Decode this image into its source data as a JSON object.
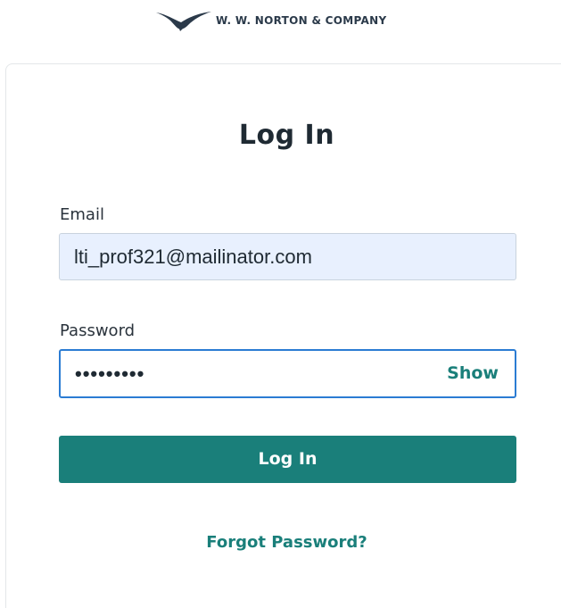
{
  "brand": {
    "name": "W. W. NORTON & COMPANY",
    "logo_icon": "seagull-icon",
    "color": "#2b3a4a"
  },
  "login_form": {
    "title": "Log In",
    "email": {
      "label": "Email",
      "value": "lti_prof321@mailinator.com",
      "background": "#e8f0fe"
    },
    "password": {
      "label": "Password",
      "masked_value": "•••••••••",
      "show_label": "Show",
      "focus_border_color": "#2b7cd3"
    },
    "submit_label": "Log In",
    "forgot_password_label": "Forgot Password?"
  },
  "colors": {
    "accent": "#1a7f7a",
    "text": "#1f2a33"
  }
}
